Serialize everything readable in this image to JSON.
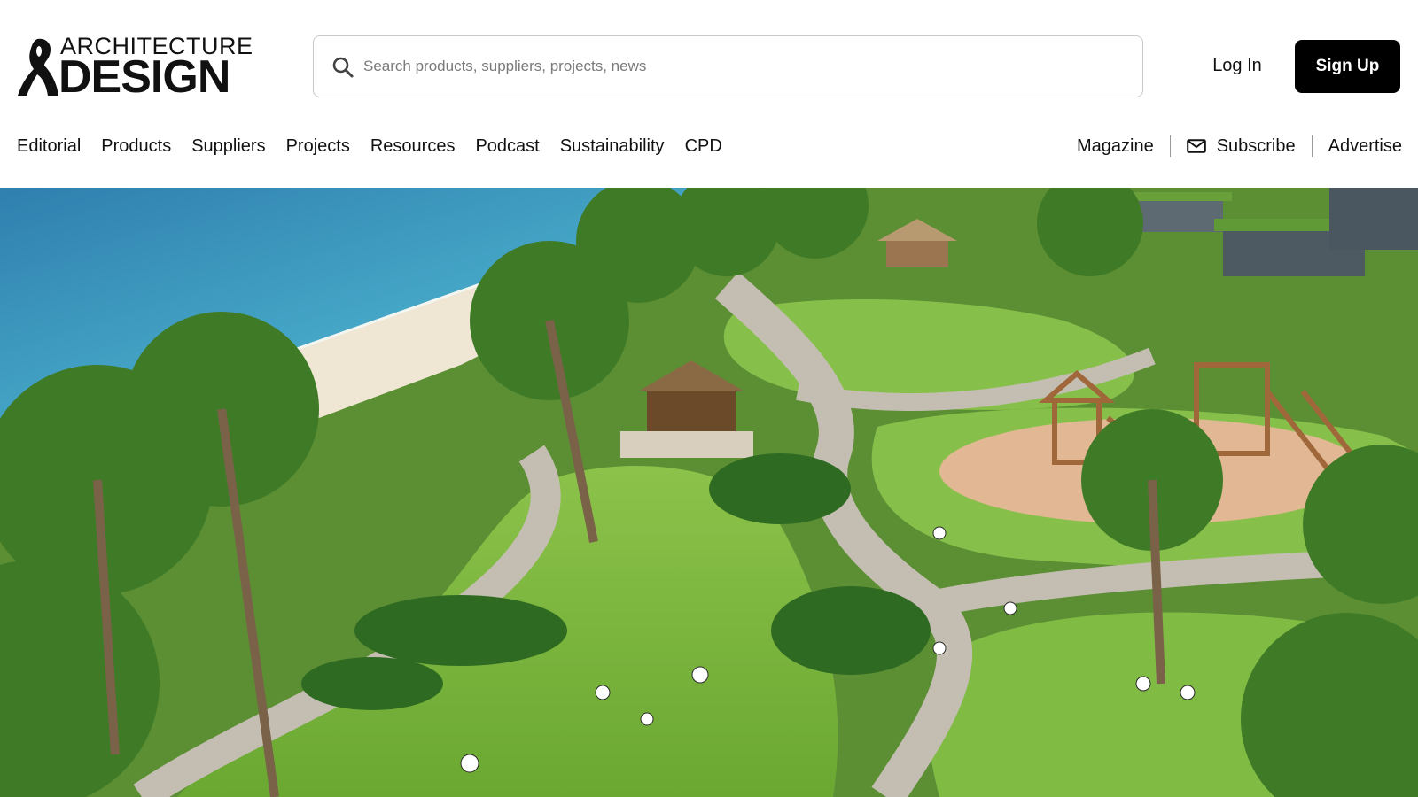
{
  "logo": {
    "line1": "ARCHITECTURE",
    "line2": "DESIGN",
    "icon": "logo-mark-icon"
  },
  "search": {
    "placeholder": "Search products, suppliers, projects, news",
    "value": "",
    "icon": "search-icon"
  },
  "auth": {
    "login_label": "Log In",
    "signup_label": "Sign Up"
  },
  "nav": {
    "primary": [
      {
        "label": "Editorial"
      },
      {
        "label": "Products"
      },
      {
        "label": "Suppliers"
      },
      {
        "label": "Projects"
      },
      {
        "label": "Resources"
      },
      {
        "label": "Podcast"
      },
      {
        "label": "Sustainability"
      },
      {
        "label": "CPD"
      }
    ],
    "secondary": {
      "magazine_label": "Magazine",
      "subscribe_label": "Subscribe",
      "subscribe_icon": "mail-icon",
      "advertise_label": "Advertise"
    }
  },
  "hero": {
    "colors": {
      "sea_deep": "#2f8fb8",
      "sea_shallow": "#7fd0d6",
      "sand": "#efe6d3",
      "grass": "#7fb83c",
      "grass_dark": "#4f8a2a",
      "path": "#bdb8ad",
      "playground": "#e2b894"
    }
  }
}
